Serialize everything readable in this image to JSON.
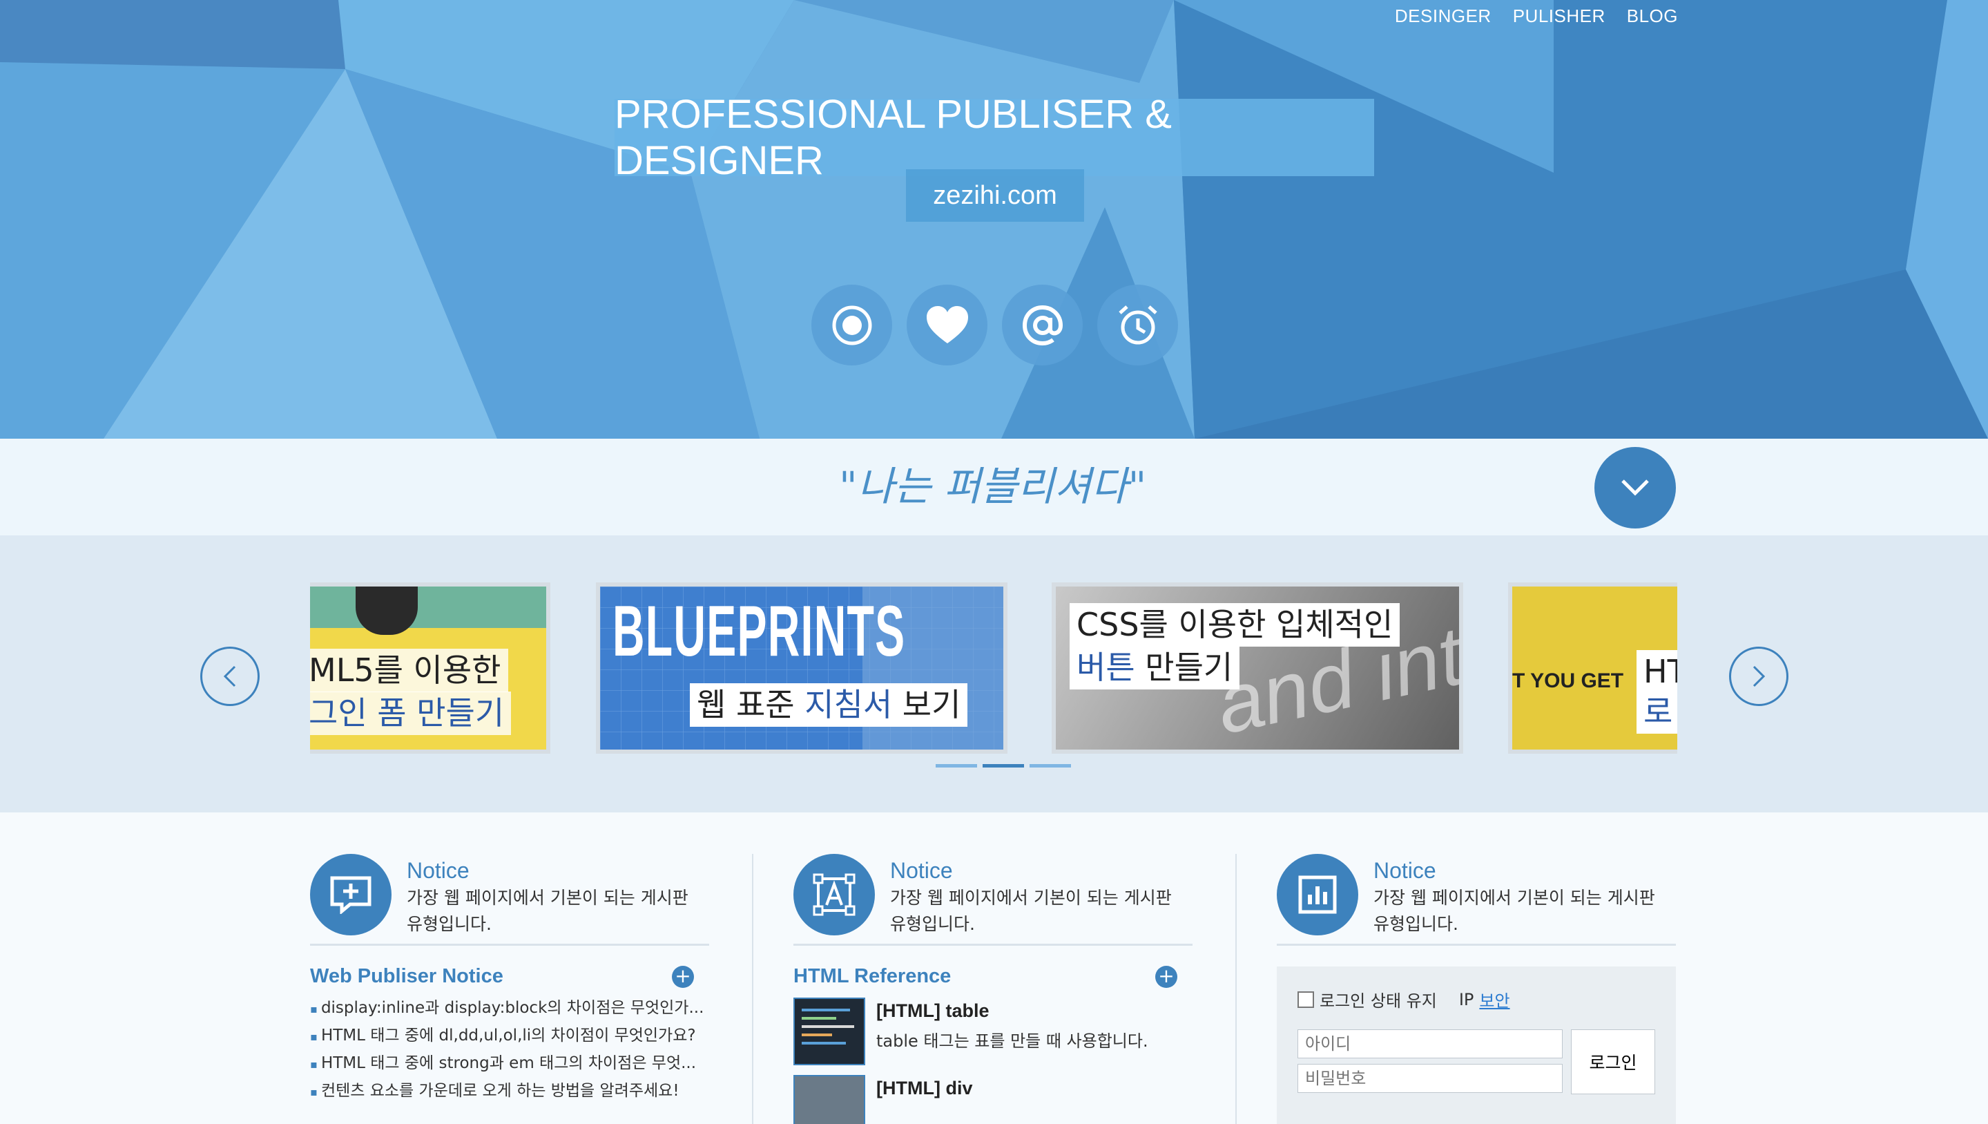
{
  "nav": {
    "items": [
      "DESINGER",
      "PULISHER",
      "BLOG"
    ]
  },
  "hero": {
    "title": "PROFESSIONAL PUBLISER & DESIGNER",
    "subtitle": "zezihi.com",
    "icons": [
      "target-icon",
      "heart-icon",
      "at-icon",
      "alarm-clock-icon"
    ]
  },
  "slogan": {
    "text": "\"나는 퍼블리셔다\""
  },
  "slider": {
    "slides": [
      {
        "line1": "ML5를 이용한",
        "line2": "그인 폼 만들기"
      },
      {
        "big": "BLUEPRINTS",
        "caption_a": "웹 표준 ",
        "caption_b": "지침서",
        "caption_c": " 보기"
      },
      {
        "line1": "CSS를 이용한 입체적인",
        "line2_a": "버튼",
        "line2_b": " 만들기",
        "bg_word": "and inte"
      },
      {
        "side": "T YOU GET",
        "line1": "HT",
        "line2": "로"
      }
    ]
  },
  "columns": [
    {
      "title": "Notice",
      "desc": "가장 웹 페이지에서 기본이 되는 게시판 유형입니다.",
      "icon": "add-note-icon"
    },
    {
      "title": "Notice",
      "desc": "가장 웹 페이지에서 기본이 되는 게시판 유형입니다.",
      "icon": "text-frame-icon"
    },
    {
      "title": "Notice",
      "desc": "가장 웹 페이지에서 기본이 되는 게시판 유형입니다.",
      "icon": "bar-chart-icon"
    }
  ],
  "web_notice": {
    "title": "Web Publiser Notice",
    "items": [
      "display:inline과 display:block의 차이점은 무엇인가...",
      "HTML 태그 중에 dl,dd,ul,ol,li의 차이점이 무엇인가요?",
      "HTML 태그 중에 strong과 em 태그의 차이점은 무엇...",
      "컨텐츠 요소를 가운데로 오게 하는 방법을 알려주세요!"
    ]
  },
  "html_ref": {
    "title": "HTML Reference",
    "items": [
      {
        "title": "[HTML] table",
        "desc": "table 태그는 표를 만들 때 사용합니다."
      },
      {
        "title": "[HTML] div",
        "desc": ""
      }
    ]
  },
  "login": {
    "keep_label": "로그인 상태 유지",
    "ip_label": "IP",
    "security_link": "보안",
    "id_placeholder": "아이디",
    "pw_placeholder": "비밀번호",
    "button": "로그인"
  },
  "colors": {
    "primary": "#3d82bd",
    "hero": "#4a90c8",
    "slider_bg": "#dde9f3"
  }
}
